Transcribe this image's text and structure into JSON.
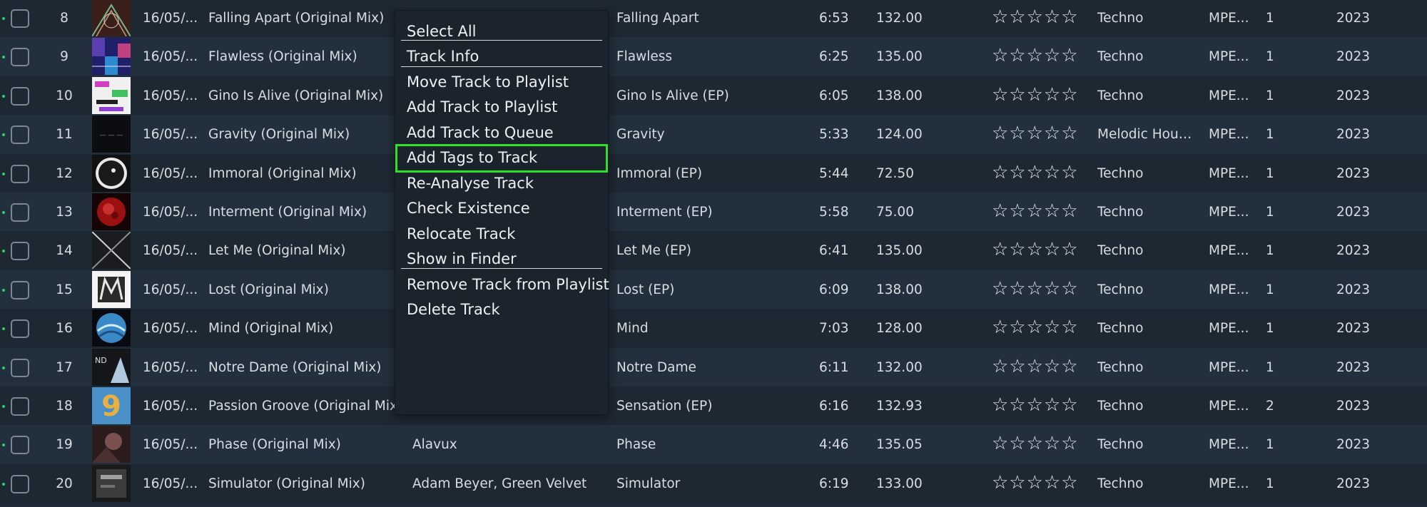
{
  "rows": [
    {
      "num": "8",
      "date": "16/05/...",
      "title": "Falling Apart (Original Mix)",
      "artist": "",
      "album": "Falling Apart",
      "time": "6:53",
      "bpm": "132.00",
      "rating": "☆☆☆☆☆",
      "genre": "Techno",
      "format": "MPE...",
      "disc": "1",
      "year": "2023"
    },
    {
      "num": "9",
      "date": "16/05/...",
      "title": "Flawless (Original Mix)",
      "artist": "",
      "album": "Flawless",
      "time": "6:25",
      "bpm": "135.00",
      "rating": "☆☆☆☆☆",
      "genre": "Techno",
      "format": "MPE...",
      "disc": "1",
      "year": "2023"
    },
    {
      "num": "10",
      "date": "16/05/...",
      "title": "Gino Is Alive (Original Mix)",
      "artist": "",
      "album": "Gino Is Alive (EP)",
      "time": "6:05",
      "bpm": "138.00",
      "rating": "☆☆☆☆☆",
      "genre": "Techno",
      "format": "MPE...",
      "disc": "1",
      "year": "2023"
    },
    {
      "num": "11",
      "date": "16/05/...",
      "title": "Gravity (Original Mix)",
      "artist": "",
      "album": "Gravity",
      "time": "5:33",
      "bpm": "124.00",
      "rating": "☆☆☆☆☆",
      "genre": "Melodic House...",
      "format": "MPE...",
      "disc": "1",
      "year": "2023"
    },
    {
      "num": "12",
      "date": "16/05/...",
      "title": "Immoral (Original Mix)",
      "artist": "",
      "album": "Immoral (EP)",
      "time": "5:44",
      "bpm": "72.50",
      "rating": "☆☆☆☆☆",
      "genre": "Techno",
      "format": "MPE...",
      "disc": "1",
      "year": "2023"
    },
    {
      "num": "13",
      "date": "16/05/...",
      "title": "Interment (Original Mix)",
      "artist": "",
      "album": "Interment (EP)",
      "time": "5:58",
      "bpm": "75.00",
      "rating": "☆☆☆☆☆",
      "genre": "Techno",
      "format": "MPE...",
      "disc": "1",
      "year": "2023"
    },
    {
      "num": "14",
      "date": "16/05/...",
      "title": "Let Me (Original Mix)",
      "artist": "",
      "album": "Let Me (EP)",
      "time": "6:41",
      "bpm": "135.00",
      "rating": "☆☆☆☆☆",
      "genre": "Techno",
      "format": "MPE...",
      "disc": "1",
      "year": "2023"
    },
    {
      "num": "15",
      "date": "16/05/...",
      "title": "Lost (Original Mix)",
      "artist": "",
      "album": "Lost (EP)",
      "time": "6:09",
      "bpm": "138.00",
      "rating": "☆☆☆☆☆",
      "genre": "Techno",
      "format": "MPE...",
      "disc": "1",
      "year": "2023"
    },
    {
      "num": "16",
      "date": "16/05/...",
      "title": "Mind (Original Mix)",
      "artist": "",
      "album": "Mind",
      "time": "7:03",
      "bpm": "128.00",
      "rating": "☆☆☆☆☆",
      "genre": "Techno",
      "format": "MPE...",
      "disc": "1",
      "year": "2023"
    },
    {
      "num": "17",
      "date": "16/05/...",
      "title": "Notre Dame (Original Mix)",
      "artist": "",
      "album": "Notre Dame",
      "time": "6:11",
      "bpm": "132.00",
      "rating": "☆☆☆☆☆",
      "genre": "Techno",
      "format": "MPE...",
      "disc": "1",
      "year": "2023"
    },
    {
      "num": "18",
      "date": "16/05/...",
      "title": "Passion Groove (Original Mix)",
      "artist": "",
      "album": "Sensation (EP)",
      "time": "6:16",
      "bpm": "132.93",
      "rating": "☆☆☆☆☆",
      "genre": "Techno",
      "format": "MPE...",
      "disc": "2",
      "year": "2023"
    },
    {
      "num": "19",
      "date": "16/05/...",
      "title": "Phase (Original Mix)",
      "artist": "Alavux",
      "album": "Phase",
      "time": "4:46",
      "bpm": "135.05",
      "rating": "☆☆☆☆☆",
      "genre": "Techno",
      "format": "MPE...",
      "disc": "1",
      "year": "2023"
    },
    {
      "num": "20",
      "date": "16/05/...",
      "title": "Simulator (Original Mix)",
      "artist": "Adam Beyer, Green Velvet",
      "album": "Simulator",
      "time": "6:19",
      "bpm": "133.00",
      "rating": "☆☆☆☆☆",
      "genre": "Techno",
      "format": "MPE...",
      "disc": "1",
      "year": "2023"
    }
  ],
  "context_menu": {
    "items": [
      {
        "label": "Select All"
      },
      {
        "label": "Track Info"
      },
      {
        "label": "Move Track to Playlist"
      },
      {
        "label": "Add Track to Playlist"
      },
      {
        "label": "Add Track to Queue"
      },
      {
        "label": "Add Tags to Track",
        "highlighted": true
      },
      {
        "label": "Re-Analyse Track"
      },
      {
        "label": "Check Existence"
      },
      {
        "label": "Relocate Track"
      },
      {
        "label": "Show in Finder"
      },
      {
        "label": "Remove Track from Playlist"
      },
      {
        "label": "Delete Track"
      }
    ]
  },
  "colors": {
    "highlight_outline": "#2ee02c",
    "status_dot": "#2fd06a",
    "row_even": "#222f3c",
    "row_odd": "#1e2833",
    "menu_bg": "#1b232c"
  }
}
